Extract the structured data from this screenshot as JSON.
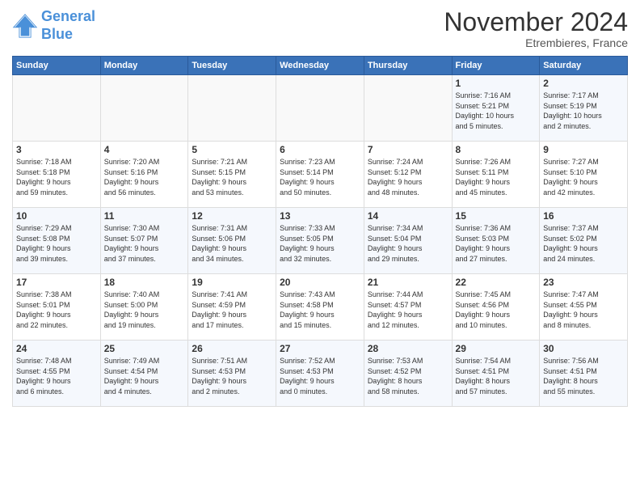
{
  "logo": {
    "line1": "General",
    "line2": "Blue"
  },
  "title": "November 2024",
  "subtitle": "Etrembieres, France",
  "days_of_week": [
    "Sunday",
    "Monday",
    "Tuesday",
    "Wednesday",
    "Thursday",
    "Friday",
    "Saturday"
  ],
  "weeks": [
    [
      {
        "day": "",
        "content": ""
      },
      {
        "day": "",
        "content": ""
      },
      {
        "day": "",
        "content": ""
      },
      {
        "day": "",
        "content": ""
      },
      {
        "day": "",
        "content": ""
      },
      {
        "day": "1",
        "content": "Sunrise: 7:16 AM\nSunset: 5:21 PM\nDaylight: 10 hours\nand 5 minutes."
      },
      {
        "day": "2",
        "content": "Sunrise: 7:17 AM\nSunset: 5:19 PM\nDaylight: 10 hours\nand 2 minutes."
      }
    ],
    [
      {
        "day": "3",
        "content": "Sunrise: 7:18 AM\nSunset: 5:18 PM\nDaylight: 9 hours\nand 59 minutes."
      },
      {
        "day": "4",
        "content": "Sunrise: 7:20 AM\nSunset: 5:16 PM\nDaylight: 9 hours\nand 56 minutes."
      },
      {
        "day": "5",
        "content": "Sunrise: 7:21 AM\nSunset: 5:15 PM\nDaylight: 9 hours\nand 53 minutes."
      },
      {
        "day": "6",
        "content": "Sunrise: 7:23 AM\nSunset: 5:14 PM\nDaylight: 9 hours\nand 50 minutes."
      },
      {
        "day": "7",
        "content": "Sunrise: 7:24 AM\nSunset: 5:12 PM\nDaylight: 9 hours\nand 48 minutes."
      },
      {
        "day": "8",
        "content": "Sunrise: 7:26 AM\nSunset: 5:11 PM\nDaylight: 9 hours\nand 45 minutes."
      },
      {
        "day": "9",
        "content": "Sunrise: 7:27 AM\nSunset: 5:10 PM\nDaylight: 9 hours\nand 42 minutes."
      }
    ],
    [
      {
        "day": "10",
        "content": "Sunrise: 7:29 AM\nSunset: 5:08 PM\nDaylight: 9 hours\nand 39 minutes."
      },
      {
        "day": "11",
        "content": "Sunrise: 7:30 AM\nSunset: 5:07 PM\nDaylight: 9 hours\nand 37 minutes."
      },
      {
        "day": "12",
        "content": "Sunrise: 7:31 AM\nSunset: 5:06 PM\nDaylight: 9 hours\nand 34 minutes."
      },
      {
        "day": "13",
        "content": "Sunrise: 7:33 AM\nSunset: 5:05 PM\nDaylight: 9 hours\nand 32 minutes."
      },
      {
        "day": "14",
        "content": "Sunrise: 7:34 AM\nSunset: 5:04 PM\nDaylight: 9 hours\nand 29 minutes."
      },
      {
        "day": "15",
        "content": "Sunrise: 7:36 AM\nSunset: 5:03 PM\nDaylight: 9 hours\nand 27 minutes."
      },
      {
        "day": "16",
        "content": "Sunrise: 7:37 AM\nSunset: 5:02 PM\nDaylight: 9 hours\nand 24 minutes."
      }
    ],
    [
      {
        "day": "17",
        "content": "Sunrise: 7:38 AM\nSunset: 5:01 PM\nDaylight: 9 hours\nand 22 minutes."
      },
      {
        "day": "18",
        "content": "Sunrise: 7:40 AM\nSunset: 5:00 PM\nDaylight: 9 hours\nand 19 minutes."
      },
      {
        "day": "19",
        "content": "Sunrise: 7:41 AM\nSunset: 4:59 PM\nDaylight: 9 hours\nand 17 minutes."
      },
      {
        "day": "20",
        "content": "Sunrise: 7:43 AM\nSunset: 4:58 PM\nDaylight: 9 hours\nand 15 minutes."
      },
      {
        "day": "21",
        "content": "Sunrise: 7:44 AM\nSunset: 4:57 PM\nDaylight: 9 hours\nand 12 minutes."
      },
      {
        "day": "22",
        "content": "Sunrise: 7:45 AM\nSunset: 4:56 PM\nDaylight: 9 hours\nand 10 minutes."
      },
      {
        "day": "23",
        "content": "Sunrise: 7:47 AM\nSunset: 4:55 PM\nDaylight: 9 hours\nand 8 minutes."
      }
    ],
    [
      {
        "day": "24",
        "content": "Sunrise: 7:48 AM\nSunset: 4:55 PM\nDaylight: 9 hours\nand 6 minutes."
      },
      {
        "day": "25",
        "content": "Sunrise: 7:49 AM\nSunset: 4:54 PM\nDaylight: 9 hours\nand 4 minutes."
      },
      {
        "day": "26",
        "content": "Sunrise: 7:51 AM\nSunset: 4:53 PM\nDaylight: 9 hours\nand 2 minutes."
      },
      {
        "day": "27",
        "content": "Sunrise: 7:52 AM\nSunset: 4:53 PM\nDaylight: 9 hours\nand 0 minutes."
      },
      {
        "day": "28",
        "content": "Sunrise: 7:53 AM\nSunset: 4:52 PM\nDaylight: 8 hours\nand 58 minutes."
      },
      {
        "day": "29",
        "content": "Sunrise: 7:54 AM\nSunset: 4:51 PM\nDaylight: 8 hours\nand 57 minutes."
      },
      {
        "day": "30",
        "content": "Sunrise: 7:56 AM\nSunset: 4:51 PM\nDaylight: 8 hours\nand 55 minutes."
      }
    ]
  ]
}
